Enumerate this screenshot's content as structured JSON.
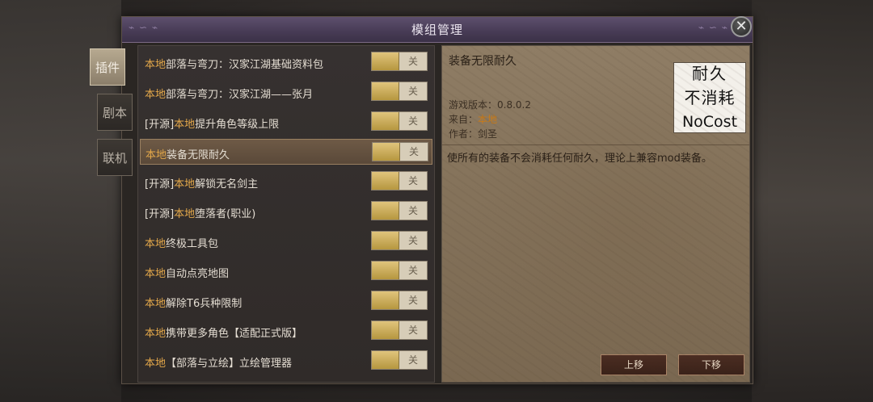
{
  "window_title": "模组管理",
  "close_glyph": "✕",
  "side_tabs": [
    {
      "label": "插件",
      "active": true
    },
    {
      "label": "剧本",
      "active": false
    },
    {
      "label": "联机",
      "active": false
    }
  ],
  "mods": [
    {
      "prefix": "",
      "local": "本地",
      "name": "部落与弯刀：汉家江湖基础资料包",
      "toggle": "关"
    },
    {
      "prefix": "",
      "local": "本地",
      "name": "部落与弯刀：汉家江湖——张月",
      "toggle": "关"
    },
    {
      "prefix": "[开源]",
      "local": "本地",
      "name": "提升角色等级上限",
      "toggle": "关"
    },
    {
      "prefix": "",
      "local": "本地",
      "name": "装备无限耐久",
      "toggle": "关"
    },
    {
      "prefix": "[开源]",
      "local": "本地",
      "name": "解锁无名剑主",
      "toggle": "关"
    },
    {
      "prefix": "[开源]",
      "local": "本地",
      "name": "堕落者(职业)",
      "toggle": "关"
    },
    {
      "prefix": "",
      "local": "本地",
      "name": "终极工具包",
      "toggle": "关"
    },
    {
      "prefix": "",
      "local": "本地",
      "name": "自动点亮地图",
      "toggle": "关"
    },
    {
      "prefix": "",
      "local": "本地",
      "name": "解除T6兵种限制",
      "toggle": "关"
    },
    {
      "prefix": "",
      "local": "本地",
      "name": "携带更多角色【适配正式版】",
      "toggle": "关"
    },
    {
      "prefix": "",
      "local": "本地",
      "name": "【部落与立绘】立绘管理器",
      "toggle": "关"
    }
  ],
  "selected_index": 3,
  "detail": {
    "title": "装备无限耐久",
    "version_label": "游戏版本：",
    "version": "0.8.0.2",
    "source_label": "来自：",
    "source": "本地",
    "author_label": "作者：",
    "author": "剑圣",
    "description": "使所有的装备不会消耗任何耐久，理论上兼容mod装备。",
    "preview_lines": [
      "耐久",
      "不消耗",
      "NoCost"
    ]
  },
  "buttons": {
    "move_up": "上移",
    "move_down": "下移"
  },
  "colors": {
    "accent_local": "#e4a84a",
    "title_bar": "#473b55",
    "toggle_knob": "#d4b465"
  }
}
